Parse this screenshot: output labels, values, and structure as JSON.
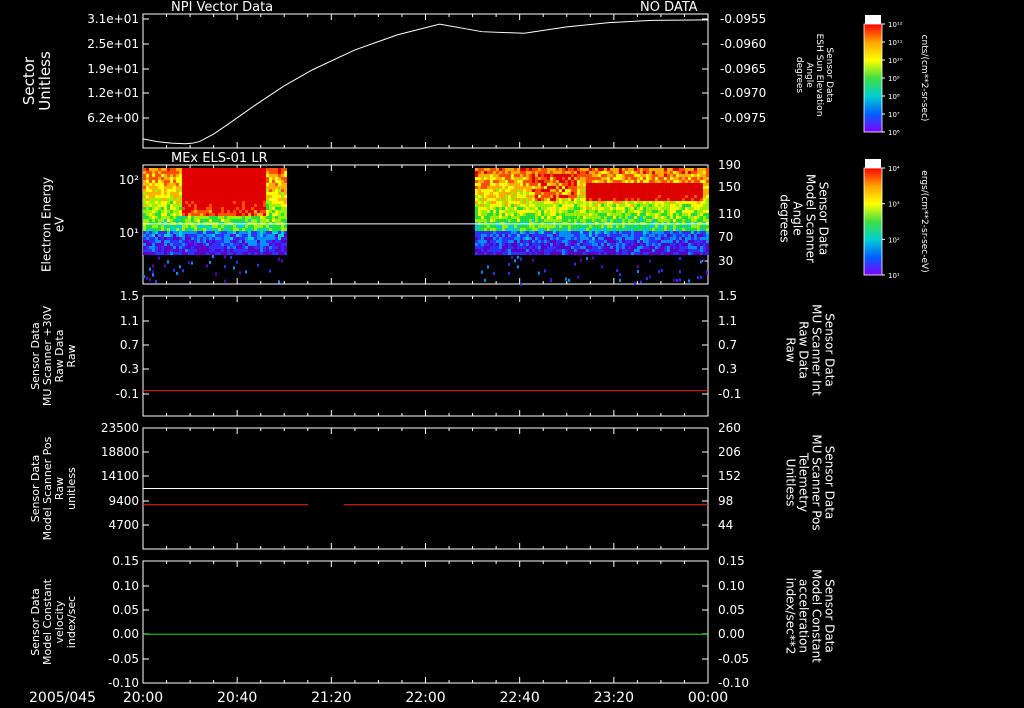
{
  "date_label": "2005/045",
  "x_ticks": [
    "20:00",
    "20:40",
    "21:20",
    "22:00",
    "22:40",
    "23:20",
    "00:00"
  ],
  "colors": {
    "background": "#000000",
    "axis": "#ffffff",
    "red_series": "#ff2020",
    "green_series": "#22dd22"
  },
  "colorbars": [
    {
      "title": "NF",
      "ticks": [
        "10¹²",
        "10¹¹",
        "10¹⁰",
        "10⁹",
        "10⁸",
        "10⁷",
        "10⁶"
      ],
      "unit": "cnts/(cm**2-sr-sec)"
    },
    {
      "title": "DEF",
      "ticks": [
        "10⁴",
        "10³",
        "10²",
        "10¹"
      ],
      "unit": "ergs/(cm**2-sr-sec-eV)"
    }
  ],
  "chart_data": [
    {
      "type": "line",
      "title_left": "NPI Vector Data",
      "title_right": "NO DATA",
      "ylabel_left": [
        "Sector",
        "Unitless"
      ],
      "ylabel_right": [
        "Sensor Data",
        "ESH Sun Elevation",
        "Angle",
        "degrees"
      ],
      "y_ticks_left": [
        "3.1e+01",
        "2.5e+01",
        "1.9e+01",
        "1.2e+01",
        "6.2e+00"
      ],
      "y_ticks_right": [
        "-0.0955",
        "-0.0960",
        "-0.0965",
        "-0.0970",
        "-0.0975"
      ],
      "ylim_right": [
        -0.0979,
        -0.0954
      ],
      "x": [
        0,
        0.1,
        0.2,
        0.3,
        0.35,
        0.4,
        0.5,
        0.6,
        0.8,
        1.0,
        1.2,
        1.5,
        1.8,
        2.1,
        2.4,
        2.7,
        3.0,
        3.3,
        3.6,
        4.0
      ],
      "series": [
        {
          "color": "#ffffff",
          "values": [
            -0.09773,
            -0.09778,
            -0.09781,
            -0.09782,
            -0.09781,
            -0.09778,
            -0.09764,
            -0.09746,
            -0.09709,
            -0.09674,
            -0.09644,
            -0.09607,
            -0.09579,
            -0.09559,
            -0.09573,
            -0.09576,
            -0.09564,
            -0.09556,
            -0.09552,
            -0.09551
          ]
        }
      ]
    },
    {
      "type": "heatmap",
      "title_left": "MEx ELS-01 LR",
      "ylabel_left": [
        "Electron Energy",
        "eV"
      ],
      "ylabel_right": [
        "Sensor Data",
        "Model Scanner",
        "Angle",
        "degrees"
      ],
      "y_ticks_left": [
        "10²",
        "10¹"
      ],
      "y_ticks_right": [
        "190",
        "150",
        "110",
        "70",
        "30"
      ],
      "ylim_right": [
        0,
        190
      ],
      "data_blocks": [
        {
          "x_start": 0,
          "x_end": 1.0
        },
        {
          "x_start": 2.35,
          "x_end": 4.0
        }
      ],
      "series": [
        {
          "color": "#ffffff",
          "x": [
            0,
            4.0
          ],
          "values": [
            96,
            96
          ]
        }
      ]
    },
    {
      "type": "line",
      "ylabel_left": [
        "Sensor Data",
        "MU Scanner +30V",
        "Raw Data",
        "Raw"
      ],
      "ylabel_right": [
        "Sensor Data",
        "MU Scanner Int",
        "Raw Data",
        "Raw"
      ],
      "y_ticks_left": [
        "1.5",
        "1.1",
        "0.7",
        "0.3",
        "-0.1"
      ],
      "y_ticks_right": [
        "1.5",
        "1.1",
        "0.7",
        "0.3",
        "-0.1"
      ],
      "ylim": [
        -0.4,
        1.5
      ],
      "series": [
        {
          "color": "#ff2020",
          "x": [
            0,
            4.0
          ],
          "values": [
            0.0,
            0.0
          ]
        }
      ]
    },
    {
      "type": "line",
      "ylabel_left": [
        "Sensor Data",
        "Model Scanner Pos",
        "Raw",
        "unitless"
      ],
      "ylabel_right": [
        "Sensor Data",
        "MU Scanner Pos",
        "Telemetry",
        "Unitless"
      ],
      "y_ticks_left": [
        "23500",
        "18800",
        "14100",
        "9400",
        "4700"
      ],
      "y_ticks_right": [
        "260",
        "206",
        "152",
        "98",
        "44"
      ],
      "ylim_left": [
        0,
        23500
      ],
      "ylim_right": [
        0,
        260
      ],
      "series": [
        {
          "color": "#ffffff",
          "axis": "left",
          "x": [
            0,
            4.0
          ],
          "values": [
            11750,
            11750
          ]
        },
        {
          "color": "#ff2020",
          "axis": "right",
          "segments": [
            [
              0,
              1.17
            ],
            [
              1.42,
              4.0
            ]
          ],
          "value": 95
        }
      ]
    },
    {
      "type": "line",
      "ylabel_left": [
        "Sensor Data",
        "Model Constant",
        "velocity",
        "index/sec"
      ],
      "ylabel_right": [
        "Sensor Data",
        "Model Constant",
        "acceleration",
        "index/sec**2"
      ],
      "y_ticks_left": [
        "0.15",
        "0.10",
        "0.05",
        "0.00",
        "-0.05",
        "-0.10"
      ],
      "y_ticks_right": [
        "0.15",
        "0.10",
        "0.05",
        "0.00",
        "-0.05",
        "-0.10"
      ],
      "ylim": [
        -0.1,
        0.15
      ],
      "series": [
        {
          "color": "#22dd22",
          "x": [
            0,
            4.0
          ],
          "values": [
            0.0,
            0.0
          ]
        }
      ]
    }
  ]
}
